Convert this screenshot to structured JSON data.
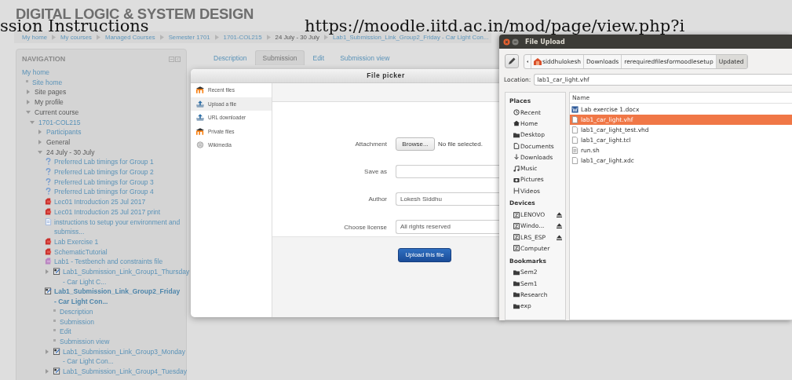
{
  "page": {
    "heading": "DIGITAL LOGIC & SYSTEM DESIGN",
    "overlay_texts": [
      "ssion Instructions",
      "https://moodle.iitd.ac.in/mod/page/view.php?i"
    ],
    "breadcrumb": [
      {
        "label": "My home",
        "link": true
      },
      {
        "label": "My courses",
        "link": true
      },
      {
        "label": "Managed Courses",
        "link": true
      },
      {
        "label": "Semester 1701",
        "link": true
      },
      {
        "label": "1701-COL215",
        "link": true
      },
      {
        "label": "24 July - 30 July",
        "link": false
      },
      {
        "label": "Lab1_Submission_Link_Group2_Friday - Car Light Con...",
        "link": true
      }
    ]
  },
  "navigation": {
    "title": "NAVIGATION",
    "tree": [
      {
        "label": "My home",
        "link": true,
        "selected": false,
        "children": [
          {
            "label": "Site home",
            "kind": "bullet",
            "link": true,
            "selected": false
          },
          {
            "label": "Site pages",
            "link": false,
            "selected": false,
            "expanded": false
          },
          {
            "label": "My profile",
            "link": false,
            "selected": false,
            "expanded": false
          },
          {
            "label": "Current course",
            "link": false,
            "selected": false,
            "expanded": true,
            "children": [
              {
                "label": "1701-COL215",
                "link": true,
                "selected": false,
                "expanded": true,
                "children": [
                  {
                    "label": "Participants",
                    "link": true,
                    "selected": false,
                    "expanded": false
                  },
                  {
                    "label": "General",
                    "link": false,
                    "selected": false,
                    "expanded": false
                  },
                  {
                    "label": "24 July - 30 July",
                    "link": false,
                    "selected": false,
                    "expanded": true,
                    "children": [
                      {
                        "label": "Preferred Lab timings for Group 1",
                        "kind": "quiz",
                        "link": true,
                        "selected": false
                      },
                      {
                        "label": "Preferred Lab timings for Group 2",
                        "kind": "quiz",
                        "link": true,
                        "selected": false
                      },
                      {
                        "label": "Preferred Lab timings for Group 3",
                        "kind": "quiz",
                        "link": true,
                        "selected": false
                      },
                      {
                        "label": "Preferred Lab timings for Group 4",
                        "kind": "quiz",
                        "link": true,
                        "selected": false
                      },
                      {
                        "label": "Lec01 Introduction 25 Jul 2017",
                        "kind": "pdf",
                        "link": true,
                        "selected": false
                      },
                      {
                        "label": "Lec01 Introduction 25 Jul 2017 print",
                        "kind": "pdf",
                        "link": true,
                        "selected": false
                      },
                      {
                        "label": "instructions to setup your environment and submiss...",
                        "kind": "page",
                        "link": true,
                        "selected": false
                      },
                      {
                        "label": "Lab Exercise 1",
                        "kind": "pdf",
                        "link": true,
                        "selected": false
                      },
                      {
                        "label": "SchematicTutorial",
                        "kind": "pdf",
                        "link": true,
                        "selected": false
                      },
                      {
                        "label": "Lab1 - Testbench and constraints file",
                        "kind": "file",
                        "link": true,
                        "selected": false
                      },
                      {
                        "label": "Lab1_Submission_Link_Group1_Thursday - Car Light C...",
                        "kind": "assign",
                        "link": true,
                        "selected": false,
                        "expanded": false
                      },
                      {
                        "label": "Lab1_Submission_Link_Group2_Friday - Car Light Con...",
                        "kind": "assign",
                        "link": true,
                        "selected": true,
                        "children": [
                          {
                            "label": "Description",
                            "kind": "bullet",
                            "link": true,
                            "selected": false
                          },
                          {
                            "label": "Submission",
                            "kind": "bullet",
                            "link": true,
                            "selected": false
                          },
                          {
                            "label": "Edit",
                            "kind": "bullet",
                            "link": true,
                            "selected": false
                          },
                          {
                            "label": "Submission view",
                            "kind": "bullet",
                            "link": true,
                            "selected": false
                          }
                        ]
                      },
                      {
                        "label": "Lab1_Submission_Link_Group3_Monday - Car Light Con...",
                        "kind": "assign",
                        "link": true,
                        "selected": false,
                        "expanded": false
                      },
                      {
                        "label": "Lab1_Submission_Link_Group4_Tuesday",
                        "kind": "assign",
                        "link": true,
                        "selected": false,
                        "expanded": false
                      }
                    ]
                  }
                ]
              }
            ]
          }
        ]
      }
    ]
  },
  "tabs": [
    {
      "label": "Description",
      "selected": false
    },
    {
      "label": "Submission",
      "selected": true
    },
    {
      "label": "Edit",
      "selected": false
    },
    {
      "label": "Submission view",
      "selected": false
    }
  ],
  "file_picker": {
    "title": "File picker",
    "sources": [
      {
        "label": "Recent files",
        "kind": "moodle",
        "selected": false
      },
      {
        "label": "Upload a file",
        "kind": "upload",
        "selected": true
      },
      {
        "label": "URL downloader",
        "kind": "upload",
        "selected": false
      },
      {
        "label": "Private files",
        "kind": "moodle",
        "selected": false
      },
      {
        "label": "Wikimedia",
        "kind": "globe",
        "selected": false
      }
    ],
    "attachment_label": "Attachment",
    "browse_button": "Browse...",
    "file_status": "No file selected.",
    "save_as_label": "Save as",
    "author_label": "Author",
    "author_value": "Lokesh Siddhu",
    "license_label": "Choose license",
    "license_value": "All rights reserved",
    "upload_button": "Upload this file"
  },
  "file_upload": {
    "title": "File Upload",
    "path": [
      {
        "label": "siddhulokesh",
        "kind": "home",
        "selected": false
      },
      {
        "label": "Downloads",
        "kind": "folder",
        "selected": false
      },
      {
        "label": "rerequiredfilesformoodlesetup",
        "kind": "folder",
        "selected": false
      },
      {
        "label": "Updated",
        "kind": "folder",
        "selected": true
      }
    ],
    "location_label": "Location:",
    "location_value": "lab1_car_light.vhf",
    "sections": [
      {
        "title": "Places",
        "items": [
          {
            "label": "Recent",
            "kind": "clock"
          },
          {
            "label": "Home",
            "kind": "home"
          },
          {
            "label": "Desktop",
            "kind": "folder"
          },
          {
            "label": "Documents",
            "kind": "document"
          },
          {
            "label": "Downloads",
            "kind": "download"
          },
          {
            "label": "Music",
            "kind": "music"
          },
          {
            "label": "Pictures",
            "kind": "camera"
          },
          {
            "label": "Videos",
            "kind": "film"
          }
        ]
      },
      {
        "title": "Devices",
        "items": [
          {
            "label": "LENOVO",
            "kind": "drive",
            "eject": true
          },
          {
            "label": "Windo...",
            "kind": "drive",
            "eject": true
          },
          {
            "label": "LRS_ESP",
            "kind": "drive",
            "eject": true
          },
          {
            "label": "Computer",
            "kind": "drive",
            "eject": false
          }
        ]
      },
      {
        "title": "Bookmarks",
        "items": [
          {
            "label": "Sem2",
            "kind": "folder"
          },
          {
            "label": "Sem1",
            "kind": "folder"
          },
          {
            "label": "Research",
            "kind": "folder"
          },
          {
            "label": "exp",
            "kind": "folder"
          }
        ]
      }
    ],
    "column": "Name",
    "files": [
      {
        "name": "Lab exercise 1.docx",
        "kind": "doc",
        "selected": false
      },
      {
        "name": "lab1_car_light.vhf",
        "kind": "text",
        "selected": true
      },
      {
        "name": "lab1_car_light_test.vhd",
        "kind": "text",
        "selected": false
      },
      {
        "name": "lab1_car_light.tcl",
        "kind": "text",
        "selected": false
      },
      {
        "name": "run.sh",
        "kind": "script",
        "selected": false
      },
      {
        "name": "lab1_car_light.xdc",
        "kind": "text",
        "selected": false
      }
    ]
  }
}
